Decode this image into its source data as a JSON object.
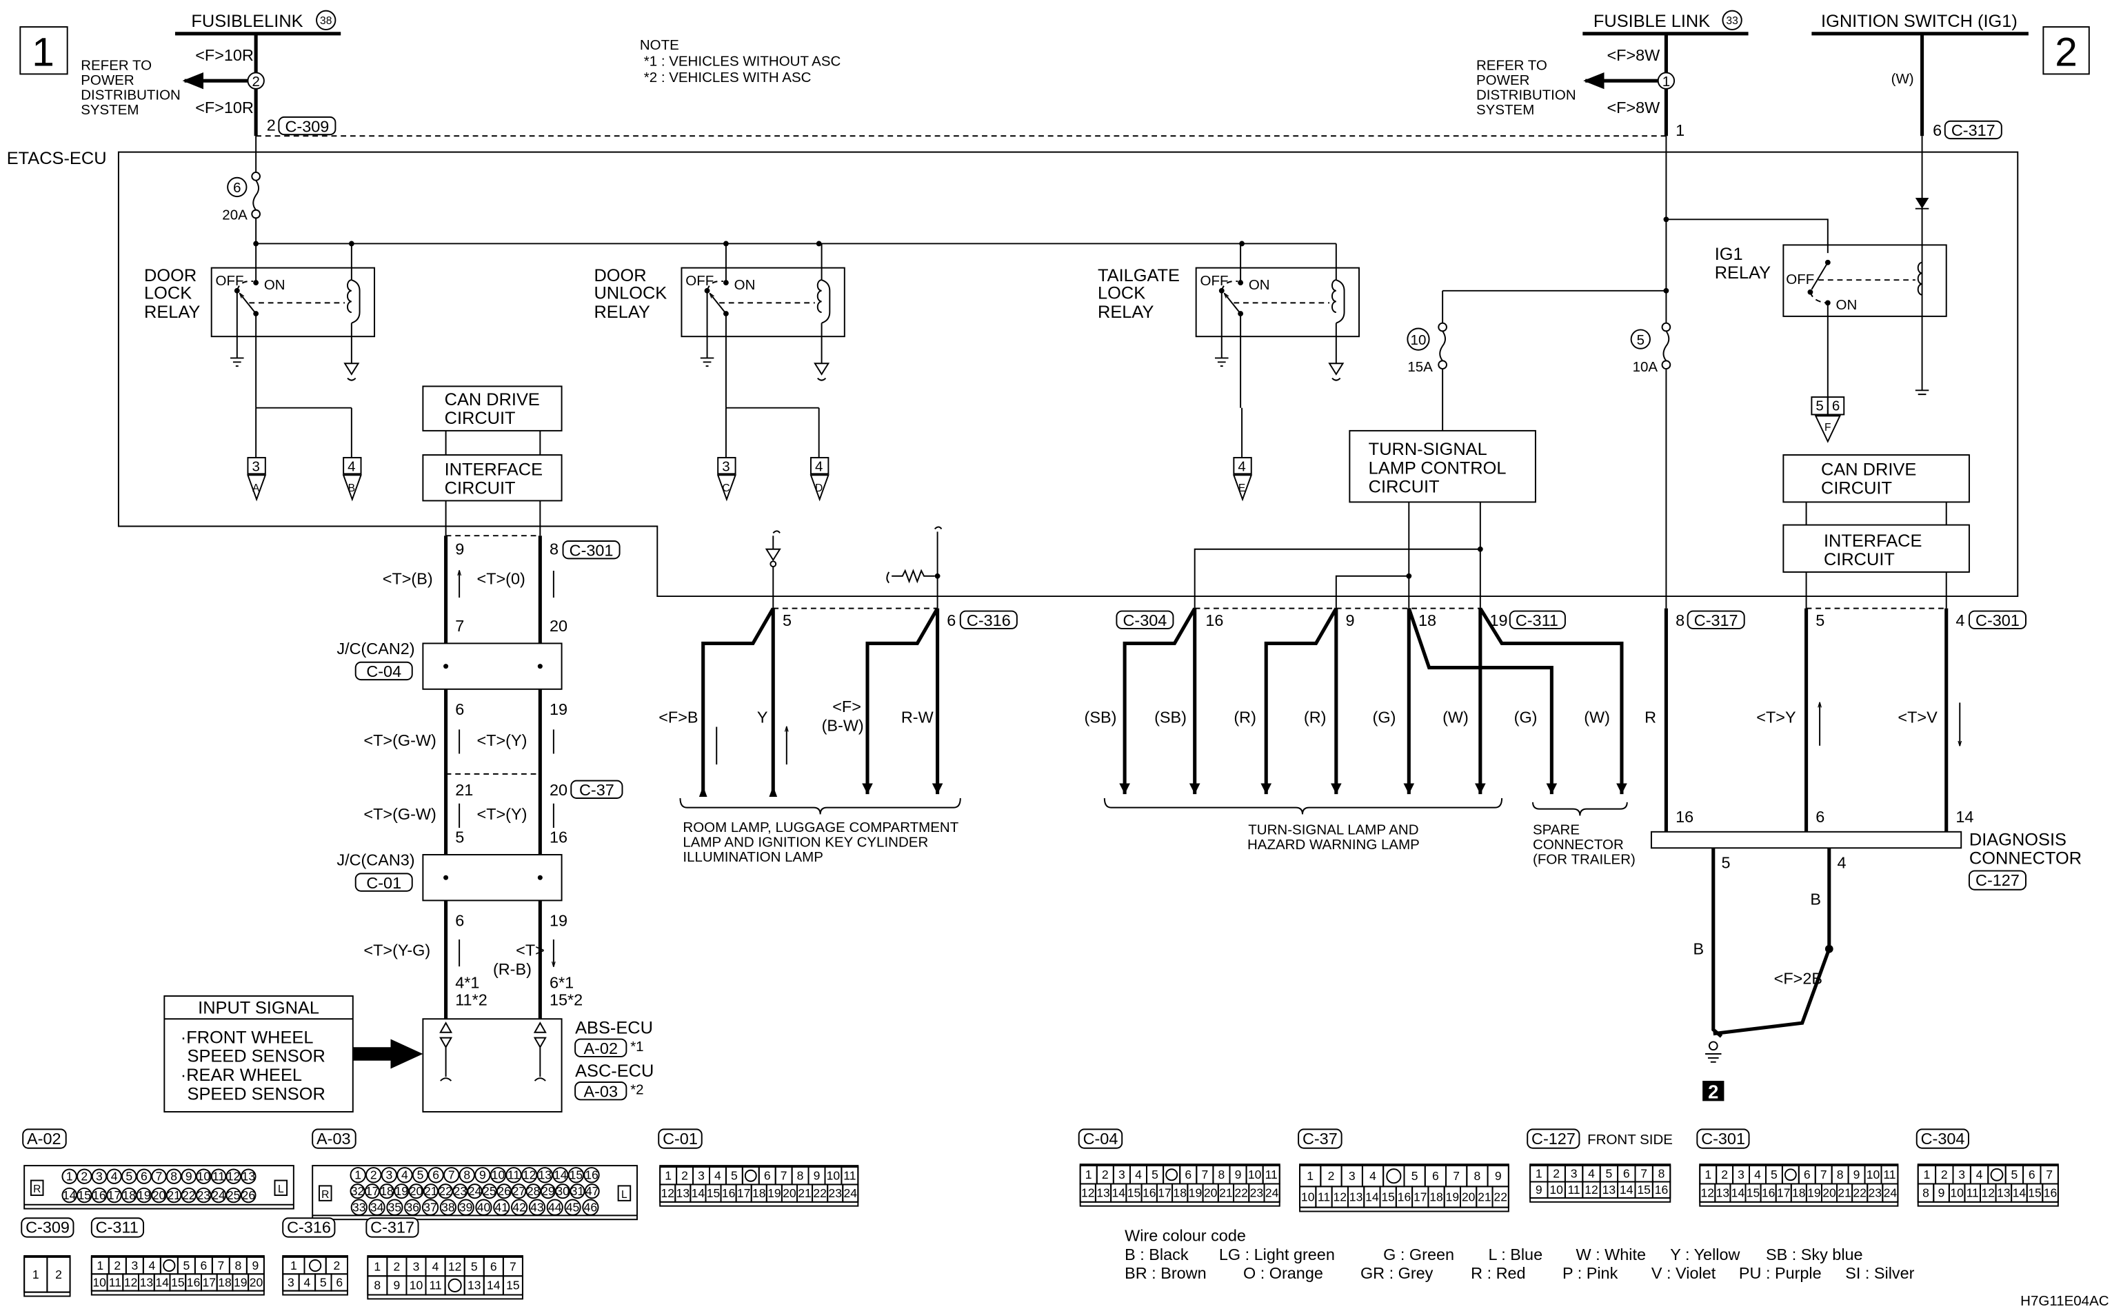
{
  "diagram_code": "H7G11E04AC",
  "page_markers": [
    "1",
    "2"
  ],
  "note": {
    "title": "NOTE",
    "items": [
      "*1 : VEHICLES WITHOUT ASC",
      "*2 : VEHICLES WITH ASC"
    ]
  },
  "fusible_link_38": {
    "label": "FUSIBLELINK",
    "number": "38",
    "wire_in": "<F>10R",
    "splice": "2",
    "wire_out": "<F>10R",
    "refer": [
      "REFER TO",
      "POWER",
      "DISTRIBUTION",
      "SYSTEM"
    ],
    "pin": "2",
    "connector": "C-309"
  },
  "fusible_link_33": {
    "label": "FUSIBLE LINK",
    "number": "33",
    "wire_in": "<F>8W",
    "splice": "1",
    "wire_out": "<F>8W",
    "refer": [
      "REFER TO",
      "POWER",
      "DISTRIBUTION",
      "SYSTEM"
    ],
    "pin": "1"
  },
  "ignition_switch": {
    "label": "IGNITION SWITCH (IG1)",
    "wire": "(W)",
    "pin": "6",
    "connector": "C-317"
  },
  "etacs": {
    "label": "ETACS-ECU",
    "fuse_main": {
      "number": "6",
      "rating": "20A"
    },
    "fuse_turn": {
      "number": "10",
      "rating": "15A"
    },
    "fuse_diag": {
      "number": "5",
      "rating": "10A"
    },
    "relays": {
      "door_lock": {
        "name": [
          "DOOR",
          "LOCK",
          "RELAY"
        ],
        "off": "OFF",
        "on": "ON",
        "outputs": [
          {
            "pin": "3",
            "ref": "A"
          },
          {
            "pin": "4",
            "ref": "B"
          }
        ]
      },
      "door_unlock": {
        "name": [
          "DOOR",
          "UNLOCK",
          "RELAY"
        ],
        "off": "OFF",
        "on": "ON",
        "outputs": [
          {
            "pin": "3",
            "ref": "C"
          },
          {
            "pin": "4",
            "ref": "D"
          }
        ]
      },
      "tailgate_lock": {
        "name": [
          "TAILGATE",
          "LOCK",
          "RELAY"
        ],
        "off": "OFF",
        "on": "ON",
        "outputs": [
          {
            "pin": "4",
            "ref": "E"
          }
        ]
      },
      "ig1": {
        "name": [
          "IG1",
          "RELAY"
        ],
        "off": "OFF",
        "on": "ON",
        "outputs": [
          {
            "pin": "5",
            "pin2": "6",
            "ref": "F"
          }
        ]
      }
    },
    "can_drive_left": [
      "CAN DRIVE",
      "CIRCUIT"
    ],
    "interface_left": [
      "INTERFACE",
      "CIRCUIT"
    ],
    "can_drive_right": [
      "CAN DRIVE",
      "CIRCUIT"
    ],
    "interface_right": [
      "INTERFACE",
      "CIRCUIT"
    ],
    "turn_signal_circuit": [
      "TURN-SIGNAL",
      "LAMP CONTROL",
      "CIRCUIT"
    ]
  },
  "can_bus": {
    "etacs_pins": {
      "left": "9",
      "right": "8",
      "connector": "C-301"
    },
    "seg1": {
      "left_wire": "<T>(B)",
      "right_wire": "<T>(0)",
      "left_pin": "7",
      "right_pin": "20"
    },
    "jc_can2": {
      "label": "J/C(CAN2)",
      "connector": "C-04"
    },
    "seg2": {
      "left_pin_top": "6",
      "right_pin_top": "19",
      "left_wire": "<T>(G-W)",
      "right_wire": "<T>(Y)",
      "left_pin": "21",
      "right_pin": "20",
      "connector": "C-37"
    },
    "seg3": {
      "left_wire": "<T>(G-W)",
      "right_wire": "<T>(Y)",
      "left_pin": "5",
      "right_pin": "16"
    },
    "jc_can3": {
      "label": "J/C(CAN3)",
      "connector": "C-01"
    },
    "seg4": {
      "left_pin_top": "6",
      "right_pin_top": "19",
      "left_wire": "<T>(Y-G)",
      "right_wire_a": "<T>",
      "right_wire_b": "(R-B)",
      "left_pin_1": "4*1",
      "left_pin_2": "11*2",
      "right_pin_1": "6*1",
      "right_pin_2": "15*2"
    },
    "abs_ecu": {
      "label": "ABS-ECU",
      "connector": "A-02",
      "note": "*1"
    },
    "asc_ecu": {
      "label": "ASC-ECU",
      "connector": "A-03",
      "note": "*2"
    },
    "input_signal": {
      "title": "INPUT SIGNAL",
      "items": [
        "·FRONT WHEEL",
        "SPEED SENSOR",
        "·REAR WHEEL",
        "SPEED SENSOR"
      ]
    }
  },
  "room_lamp": {
    "pins": [
      "5",
      "6"
    ],
    "connector": "C-316",
    "wires": [
      "<F>B",
      "Y",
      "<F>",
      "(B-W)",
      "R-W"
    ],
    "caption": [
      "ROOM LAMP, LUGGAGE COMPARTMENT",
      "LAMP AND IGNITION KEY CYLINDER",
      "ILLUMINATION LAMP"
    ]
  },
  "turn_signal": {
    "connector_left": "C-304",
    "connector_right": "C-311",
    "pins": [
      "16",
      "9",
      "18",
      "19"
    ],
    "wires": [
      "(SB)",
      "(SB)",
      "(R)",
      "(R)",
      "(G)",
      "(W)",
      "(G)",
      "(W)"
    ],
    "caption": [
      "TURN-SIGNAL LAMP AND",
      "HAZARD WARNING LAMP"
    ],
    "spare_caption": [
      "SPARE",
      "CONNECTOR",
      "(FOR TRAILER)"
    ]
  },
  "diagnosis": {
    "power": {
      "pin": "8",
      "connector": "C-317",
      "wire": "R",
      "diag_pin": "16"
    },
    "can_h": {
      "pin": "5",
      "wire": "<T>Y",
      "diag_pin": "6"
    },
    "can_l": {
      "pin": "4",
      "connector": "C-301",
      "wire": "<T>V",
      "diag_pin": "14"
    },
    "label": [
      "DIAGNOSIS",
      "CONNECTOR"
    ],
    "connector": "C-127",
    "ground_pins": [
      "5",
      "4"
    ],
    "ground_wires": [
      "B",
      "B",
      "<F>2B"
    ],
    "ground_ref": "2"
  },
  "connectors": [
    {
      "id": "A-02",
      "style": "round",
      "side_marks": [
        "R",
        "L"
      ],
      "rows": [
        [
          "1",
          "2",
          "3",
          "4",
          "5",
          "6",
          "7",
          "8",
          "9",
          "10",
          "11",
          "12",
          "13"
        ],
        [
          "14",
          "15",
          "16",
          "17",
          "18",
          "19",
          "20",
          "21",
          "22",
          "23",
          "24",
          "25",
          "26"
        ]
      ]
    },
    {
      "id": "A-03",
      "style": "round",
      "side_marks": [
        "R",
        "L"
      ],
      "rows": [
        [
          "1",
          "2",
          "3",
          "4",
          "5",
          "6",
          "7",
          "8",
          "9",
          "10",
          "11",
          "12",
          "13",
          "14",
          "15",
          "16"
        ],
        [
          "32",
          "17",
          "18",
          "19",
          "20",
          "21",
          "22",
          "23",
          "24",
          "25",
          "26",
          "27",
          "28",
          "29",
          "30",
          "31",
          "47"
        ],
        [
          "33",
          "34",
          "35",
          "36",
          "37",
          "38",
          "39",
          "40",
          "41",
          "42",
          "43",
          "44",
          "45",
          "46"
        ]
      ]
    },
    {
      "id": "C-01",
      "style": "grid",
      "rows": [
        [
          "1",
          "2",
          "3",
          "4",
          "5",
          "",
          "6",
          "7",
          "8",
          "9",
          "10",
          "11"
        ],
        [
          "12",
          "13",
          "14",
          "15",
          "16",
          "17",
          "18",
          "19",
          "20",
          "21",
          "22",
          "23",
          "24"
        ]
      ]
    },
    {
      "id": "C-309",
      "style": "grid",
      "rows": [
        [
          "1",
          "2"
        ]
      ]
    },
    {
      "id": "C-311",
      "style": "grid",
      "rows": [
        [
          "1",
          "2",
          "3",
          "4",
          "",
          "5",
          "6",
          "7",
          "8",
          "9"
        ],
        [
          "10",
          "11",
          "12",
          "13",
          "14",
          "15",
          "16",
          "17",
          "18",
          "19",
          "20"
        ]
      ]
    },
    {
      "id": "C-316",
      "style": "grid",
      "rows": [
        [
          "1",
          "",
          "2"
        ],
        [
          "3",
          "4",
          "5",
          "6"
        ]
      ]
    },
    {
      "id": "C-317",
      "style": "grid",
      "rows": [
        [
          "1",
          "2",
          "3",
          "4",
          "12",
          "5",
          "6",
          "7"
        ],
        [
          "8",
          "9",
          "10",
          "11",
          "",
          "13",
          "14",
          "15"
        ]
      ]
    },
    {
      "id": "C-04",
      "style": "grid",
      "rows": [
        [
          "1",
          "2",
          "3",
          "4",
          "5",
          "",
          "6",
          "7",
          "8",
          "9",
          "10",
          "11"
        ],
        [
          "12",
          "13",
          "14",
          "15",
          "16",
          "17",
          "18",
          "19",
          "20",
          "21",
          "22",
          "23",
          "24"
        ]
      ]
    },
    {
      "id": "C-37",
      "style": "grid",
      "rows": [
        [
          "1",
          "2",
          "3",
          "4",
          "",
          "5",
          "6",
          "7",
          "8",
          "9"
        ],
        [
          "10",
          "11",
          "12",
          "13",
          "14",
          "15",
          "16",
          "17",
          "18",
          "19",
          "20",
          "21",
          "22"
        ]
      ]
    },
    {
      "id": "C-127",
      "style": "grid",
      "caption": "FRONT SIDE",
      "rows": [
        [
          "1",
          "2",
          "3",
          "4",
          "5",
          "6",
          "7",
          "8"
        ],
        [
          "9",
          "10",
          "11",
          "12",
          "13",
          "14",
          "15",
          "16"
        ]
      ]
    },
    {
      "id": "C-301",
      "style": "grid",
      "rows": [
        [
          "1",
          "2",
          "3",
          "4",
          "5",
          "",
          "6",
          "7",
          "8",
          "9",
          "10",
          "11"
        ],
        [
          "12",
          "13",
          "14",
          "15",
          "16",
          "17",
          "18",
          "19",
          "20",
          "21",
          "22",
          "23",
          "24"
        ]
      ]
    },
    {
      "id": "C-304",
      "style": "grid",
      "rows": [
        [
          "1",
          "2",
          "3",
          "4",
          "",
          "5",
          "6",
          "7"
        ],
        [
          "8",
          "9",
          "10",
          "11",
          "12",
          "13",
          "14",
          "15",
          "16"
        ]
      ]
    }
  ],
  "wire_colour_code": {
    "title": "Wire colour code",
    "rows": [
      [
        "B : Black",
        "LG : Light green",
        "G : Green",
        "L : Blue",
        "W : White",
        "Y : Yellow",
        "SB : Sky blue"
      ],
      [
        "BR : Brown",
        "O : Orange",
        "GR : Grey",
        "R : Red",
        "P : Pink",
        "V : Violet",
        "PU : Purple",
        "SI : Silver"
      ]
    ]
  }
}
